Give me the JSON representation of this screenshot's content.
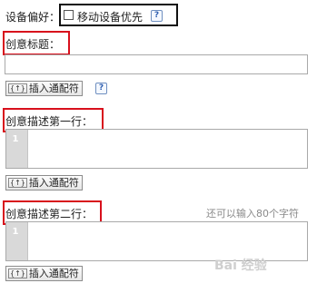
{
  "device": {
    "label": "设备偏好：",
    "checkbox_label": "移动设备优先",
    "help": "?"
  },
  "title_section": {
    "label": "创意标题：",
    "value": "",
    "insert_button": "插入通配符",
    "insert_icon_text": "{↑}",
    "help": "?"
  },
  "line1_section": {
    "label": "创意描述第一行：",
    "line_number": "1",
    "value": "",
    "insert_button": "插入通配符",
    "insert_icon_text": "{↑}"
  },
  "line2_section": {
    "label": "创意描述第二行：",
    "hint": "还可以输入80个字符",
    "line_number": "1",
    "value": "",
    "insert_button": "插入通配符",
    "insert_icon_text": "{↑}"
  },
  "watermark": "Bai 经验"
}
